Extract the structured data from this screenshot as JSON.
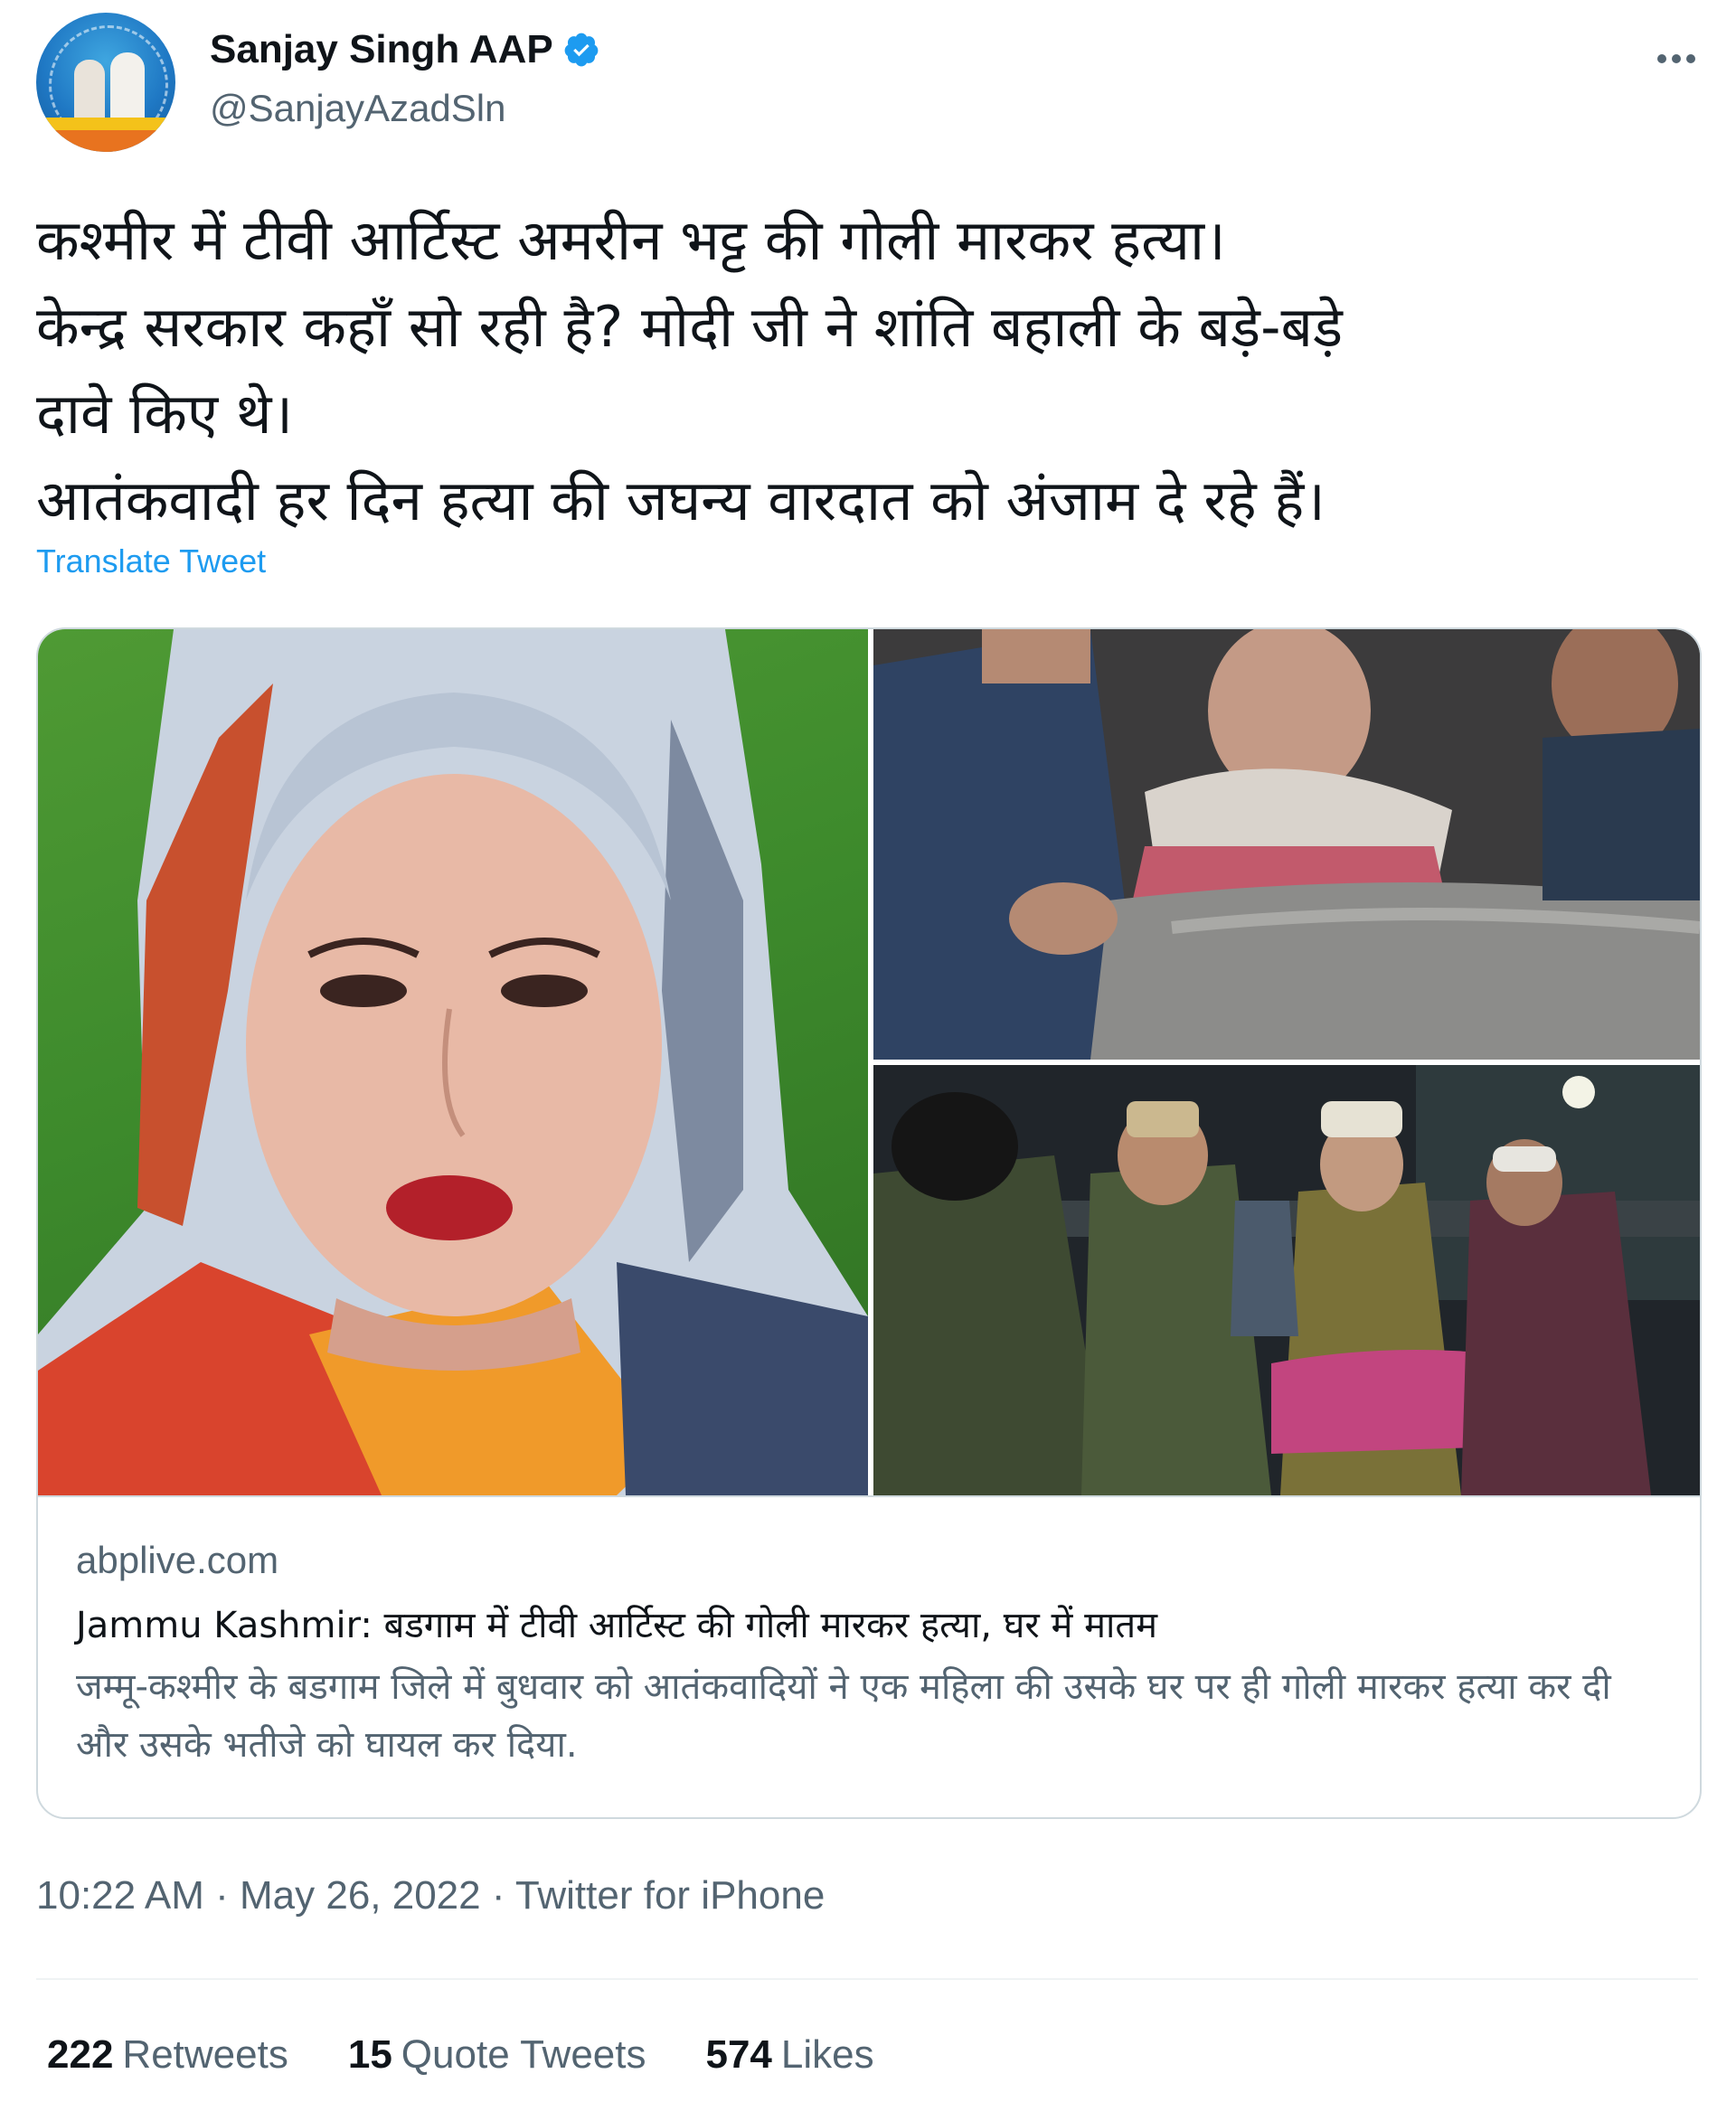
{
  "author": {
    "display_name": "Sanjay Singh AAP",
    "handle": "@SanjayAzadSln",
    "verified": true
  },
  "tweet": {
    "lines": [
      "कश्मीर में टीवी आर्टिस्ट अमरीन भट्ट की गोली मारकर हत्या।",
      "केन्द्र सरकार कहाँ सो रही है? मोदी जी ने शांति बहाली के बड़े-बड़े",
      "दावे किए थे।",
      "आतंकवादी हर दिन हत्या की जघन्य वारदात को अंजाम दे रहे हैं।"
    ],
    "translate_label": "Translate Tweet"
  },
  "card": {
    "domain": "abplive.com",
    "title": "Jammu Kashmir: बडगाम में टीवी आर्टिस्ट की गोली मारकर हत्या, घर में मातम",
    "description": "जम्मू-कश्मीर के बडगाम जिले में बुधवार को आतंकवादियों ने एक महिला की उसके घर पर ही गोली मारकर हत्या कर दी और उसके भतीजे को घायल कर दिया."
  },
  "meta": {
    "timestamp": "10:22 AM · May 26, 2022 · Twitter for iPhone"
  },
  "stats": {
    "retweets_count": "222",
    "retweets_label": "Retweets",
    "quotes_count": "15",
    "quotes_label": "Quote Tweets",
    "likes_count": "574",
    "likes_label": "Likes"
  },
  "icons": {
    "verified": "verified-badge-icon",
    "more": "more-options-icon"
  },
  "colors": {
    "link": "#1d9bf0",
    "verified": "#1d9bf0",
    "secondary_text": "#536471",
    "border": "#cfd9de"
  }
}
